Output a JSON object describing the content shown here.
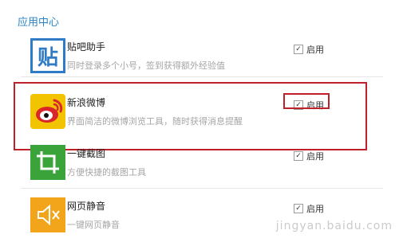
{
  "section_title": "应用中心",
  "apps": [
    {
      "name": "贴吧助手",
      "desc": "同时登录多个小号，签到获得额外经验值",
      "enable_label": "启用",
      "checked_glyph": "✓",
      "icon_glyph": "贴",
      "icon_name": "tieba-helper-icon",
      "icon_color": "#2f7bc5"
    },
    {
      "name": "新浪微博",
      "desc": "界面简洁的微博浏览工具，随时获得消息提醒",
      "enable_label": "启用",
      "checked_glyph": "✓",
      "icon_glyph": "",
      "icon_name": "weibo-icon",
      "icon_color": "#f2c400"
    },
    {
      "name": "一键截图",
      "desc": "方便快捷的截图工具",
      "enable_label": "启用",
      "checked_glyph": "✓",
      "icon_glyph": "⛶",
      "icon_name": "crop-icon",
      "icon_color": "#3aa43a"
    },
    {
      "name": "网页静音",
      "desc": "一键网页静音",
      "enable_label": "启用",
      "checked_glyph": "✓",
      "icon_glyph": "🔇",
      "icon_name": "mute-icon",
      "icon_color": "#f2a51a"
    }
  ],
  "watermark": "jingyan.baidu.com"
}
